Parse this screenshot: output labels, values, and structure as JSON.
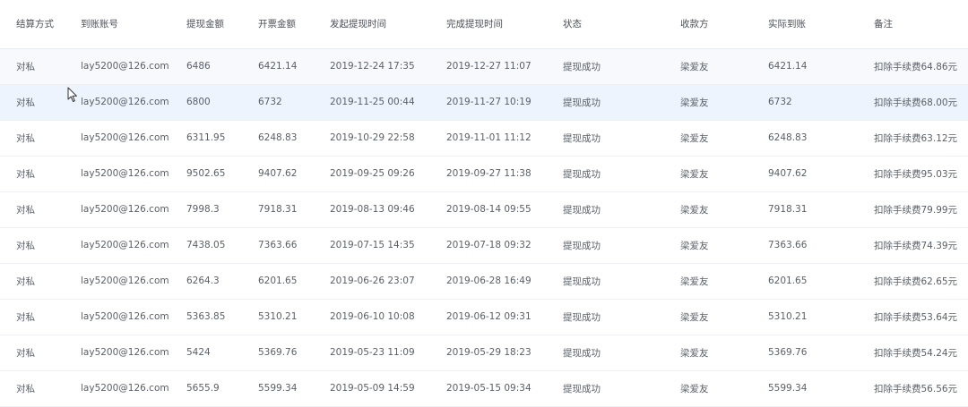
{
  "table": {
    "headers": [
      "结算方式",
      "到账账号",
      "提现金额",
      "开票金额",
      "发起提现时间",
      "完成提现时间",
      "状态",
      "收款方",
      "实际到账",
      "备注"
    ],
    "rows": [
      [
        "对私",
        "lay5200@126.com",
        "6486",
        "6421.14",
        "2019-12-24 17:35",
        "2019-12-27 11:07",
        "提现成功",
        "梁爱友",
        "6421.14",
        "扣除手续费64.86元"
      ],
      [
        "对私",
        "lay5200@126.com",
        "6800",
        "6732",
        "2019-11-25 00:44",
        "2019-11-27 10:19",
        "提现成功",
        "梁爱友",
        "6732",
        "扣除手续费68.00元"
      ],
      [
        "对私",
        "lay5200@126.com",
        "6311.95",
        "6248.83",
        "2019-10-29 22:58",
        "2019-11-01 11:12",
        "提现成功",
        "梁爱友",
        "6248.83",
        "扣除手续费63.12元"
      ],
      [
        "对私",
        "lay5200@126.com",
        "9502.65",
        "9407.62",
        "2019-09-25 09:26",
        "2019-09-27 11:38",
        "提现成功",
        "梁爱友",
        "9407.62",
        "扣除手续费95.03元"
      ],
      [
        "对私",
        "lay5200@126.com",
        "7998.3",
        "7918.31",
        "2019-08-13 09:46",
        "2019-08-14 09:55",
        "提现成功",
        "梁爱友",
        "7918.31",
        "扣除手续费79.99元"
      ],
      [
        "对私",
        "lay5200@126.com",
        "7438.05",
        "7363.66",
        "2019-07-15 14:35",
        "2019-07-18 09:32",
        "提现成功",
        "梁爱友",
        "7363.66",
        "扣除手续费74.39元"
      ],
      [
        "对私",
        "lay5200@126.com",
        "6264.3",
        "6201.65",
        "2019-06-26 23:07",
        "2019-06-28 16:49",
        "提现成功",
        "梁爱友",
        "6201.65",
        "扣除手续费62.65元"
      ],
      [
        "对私",
        "lay5200@126.com",
        "5363.85",
        "5310.21",
        "2019-06-10 10:08",
        "2019-06-12 09:31",
        "提现成功",
        "梁爱友",
        "5310.21",
        "扣除手续费53.64元"
      ],
      [
        "对私",
        "lay5200@126.com",
        "5424",
        "5369.76",
        "2019-05-23 11:09",
        "2019-05-29 18:23",
        "提现成功",
        "梁爱友",
        "5369.76",
        "扣除手续费54.24元"
      ],
      [
        "对私",
        "lay5200@126.com",
        "5655.9",
        "5599.34",
        "2019-05-09 14:59",
        "2019-05-15 09:34",
        "提现成功",
        "梁爱友",
        "5599.34",
        "扣除手续费56.56元"
      ]
    ]
  }
}
